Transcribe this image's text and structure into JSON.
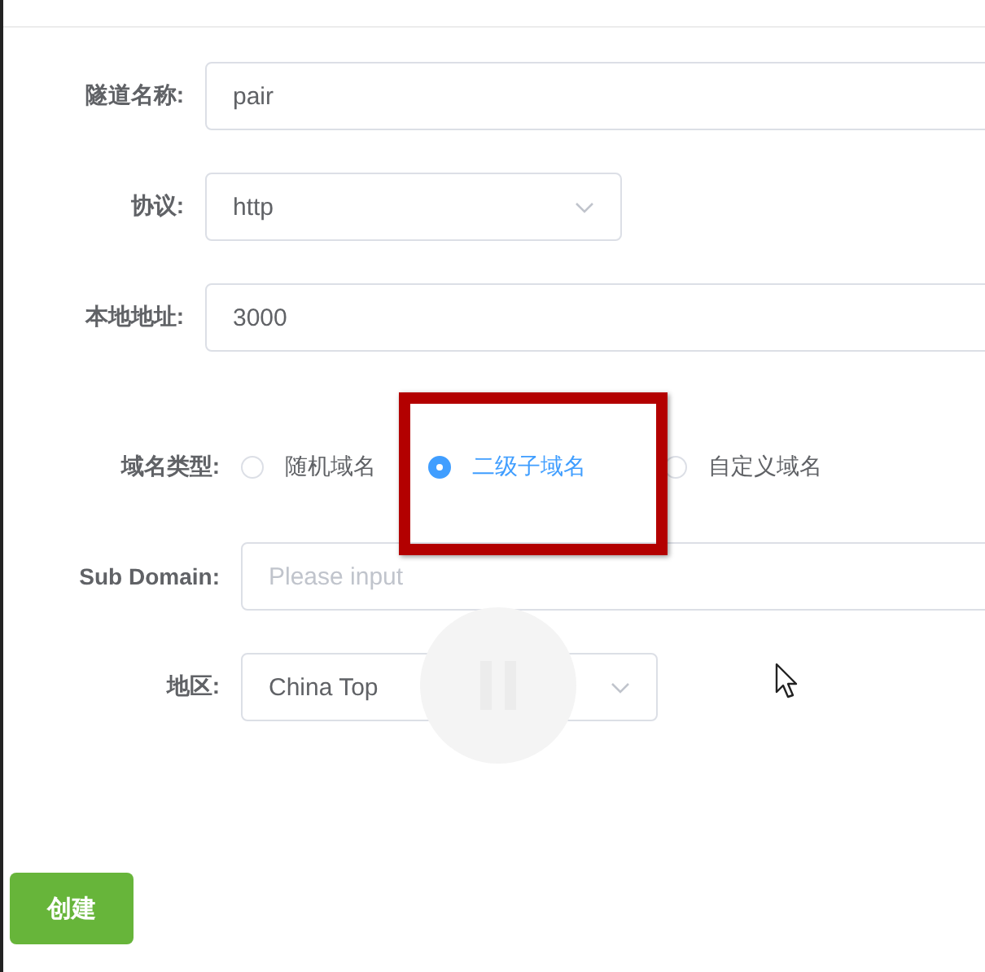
{
  "form": {
    "groups": [
      {
        "fields": [
          {
            "kind": "input",
            "label": "隧道名称:",
            "value": "pair"
          },
          {
            "kind": "select",
            "label": "协议:",
            "value": "http"
          },
          {
            "kind": "input",
            "label": "本地地址:",
            "value": "3000"
          }
        ]
      },
      {
        "fields": [
          {
            "kind": "radio",
            "label": "域名类型:",
            "options": [
              {
                "label": "随机域名",
                "selected": false
              },
              {
                "label": "二级子域名",
                "selected": true
              },
              {
                "label": "自定义域名",
                "selected": false
              }
            ]
          },
          {
            "kind": "input",
            "label": "Sub Domain:",
            "placeholder": "Please input"
          },
          {
            "kind": "select",
            "label": "地区:",
            "value": "China Top"
          }
        ]
      }
    ]
  },
  "submit_button": "创建"
}
